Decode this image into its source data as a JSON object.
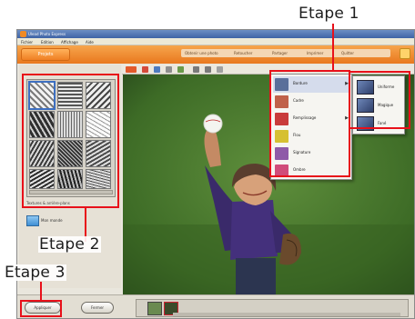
{
  "app": {
    "title": "Ulead Photo Express",
    "menu": [
      "Fichier",
      "Edition",
      "Affichage",
      "Aide"
    ],
    "mode_label": "Projets",
    "nav": [
      "Obtenir une photo",
      "Retoucher",
      "Partager",
      "Imprimer",
      "Quitter"
    ]
  },
  "sidebar": {
    "filter_label": "Textures & arrière-plans",
    "sub_label": "Mon monde"
  },
  "context_menu": {
    "items": [
      {
        "label": "Bordure",
        "has_submenu": true,
        "icon_color": "#5a6f9a"
      },
      {
        "label": "Cadre",
        "has_submenu": false,
        "icon_color": "#c0614a"
      },
      {
        "label": "Remplissage",
        "has_submenu": true,
        "icon_color": "#c93b3b"
      },
      {
        "label": "Flou",
        "has_submenu": false,
        "icon_color": "#d6c032"
      },
      {
        "label": "Signature",
        "has_submenu": false,
        "icon_color": "#8f5aa8"
      },
      {
        "label": "Ombre",
        "has_submenu": false,
        "icon_color": "#d04c7a"
      }
    ]
  },
  "submenu": {
    "items": [
      {
        "label": "Uniforme"
      },
      {
        "label": "Magique"
      },
      {
        "label": "Fané"
      }
    ]
  },
  "buttons": {
    "apply": "Appliquer",
    "close": "Fermer"
  },
  "annotations": {
    "step1": "Etape 1",
    "step2": "Etape 2",
    "step3": "Etape 3"
  },
  "colors": {
    "annotation_red": "#e8101a",
    "brand_orange": "#ef7f23"
  }
}
